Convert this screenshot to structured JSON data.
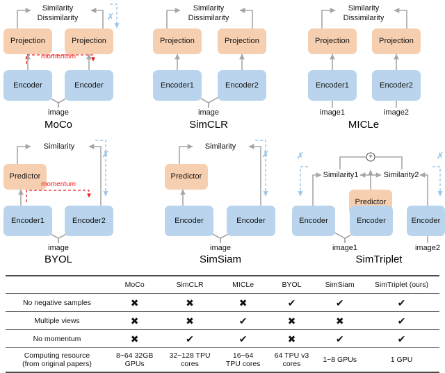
{
  "figure": {
    "diagrams": [
      {
        "id": "moco",
        "title": "MoCo",
        "top_labels": [
          "Similarity",
          "Dissimilarity"
        ],
        "boxes": [
          {
            "name": "projection-left",
            "label": "Projection"
          },
          {
            "name": "projection-right",
            "label": "Projection"
          },
          {
            "name": "encoder-left",
            "label": "Encoder"
          },
          {
            "name": "encoder-right",
            "label": "Encoder"
          }
        ],
        "input_labels": [
          "image"
        ],
        "momentum_label": "momentum",
        "stop_gradient_symbol": "✗"
      },
      {
        "id": "simclr",
        "title": "SimCLR",
        "top_labels": [
          "Similarity",
          "Dissimilarity"
        ],
        "boxes": [
          {
            "name": "projection-left",
            "label": "Projection"
          },
          {
            "name": "projection-right",
            "label": "Projection"
          },
          {
            "name": "encoder-left",
            "label": "Encoder1"
          },
          {
            "name": "encoder-right",
            "label": "Encoder2"
          }
        ],
        "input_labels": [
          "image"
        ]
      },
      {
        "id": "micle",
        "title": "MICLe",
        "top_labels": [
          "Similarity",
          "Dissimilarity"
        ],
        "boxes": [
          {
            "name": "projection-left",
            "label": "Projection"
          },
          {
            "name": "projection-right",
            "label": "Projection"
          },
          {
            "name": "encoder-left",
            "label": "Encoder1"
          },
          {
            "name": "encoder-right",
            "label": "Encoder2"
          }
        ],
        "input_labels": [
          "image1",
          "image2"
        ]
      },
      {
        "id": "byol",
        "title": "BYOL",
        "top_labels": [
          "Similarity"
        ],
        "boxes": [
          {
            "name": "predictor",
            "label": "Predictor"
          },
          {
            "name": "encoder-left",
            "label": "Encoder1"
          },
          {
            "name": "encoder-right",
            "label": "Encoder2"
          }
        ],
        "input_labels": [
          "image"
        ],
        "momentum_label": "momentum",
        "stop_gradient_symbol": "✗"
      },
      {
        "id": "simsiam",
        "title": "SimSiam",
        "top_labels": [
          "Similarity"
        ],
        "boxes": [
          {
            "name": "predictor",
            "label": "Predictor"
          },
          {
            "name": "encoder-left",
            "label": "Encoder"
          },
          {
            "name": "encoder-right",
            "label": "Encoder"
          }
        ],
        "input_labels": [
          "image"
        ],
        "stop_gradient_symbol": "✗"
      },
      {
        "id": "simtriplet",
        "title": "SimTriplet",
        "top_labels": [
          "Similarity1",
          "Similarity2"
        ],
        "sum_symbol": "+",
        "boxes": [
          {
            "name": "predictor",
            "label": "Predictor"
          },
          {
            "name": "encoder-left",
            "label": "Encoder"
          },
          {
            "name": "encoder-middle",
            "label": "Encoder"
          },
          {
            "name": "encoder-right",
            "label": "Encoder"
          }
        ],
        "input_labels": [
          "image1",
          "image2"
        ],
        "stop_gradient_symbol": "✗"
      }
    ]
  },
  "table": {
    "columns": [
      "",
      "MoCo",
      "SimCLR",
      "MICLe",
      "BYOL",
      "SimSiam",
      "SimTriplet (ours)"
    ],
    "rows": [
      {
        "label": "No negative samples",
        "values": [
          "no",
          "no",
          "no",
          "yes",
          "yes",
          "yes"
        ]
      },
      {
        "label": "Multiple views",
        "values": [
          "no",
          "no",
          "yes",
          "no",
          "no",
          "yes"
        ]
      },
      {
        "label": "No momentum",
        "values": [
          "no",
          "yes",
          "yes",
          "no",
          "yes",
          "yes"
        ]
      }
    ],
    "last_row": {
      "label_line1": "Computing resource",
      "label_line2": "(from original papers)",
      "values": [
        {
          "line1": "8~64 32GB",
          "line2": "GPUs"
        },
        {
          "line1": "32~128 TPU",
          "line2": "cores"
        },
        {
          "line1": "16~64",
          "line2": "TPU cores"
        },
        {
          "line1": "64 TPU v3",
          "line2": "cores"
        },
        {
          "line1": "1~8 GPUs",
          "line2": ""
        },
        {
          "line1": "1 GPU",
          "line2": ""
        }
      ]
    },
    "marks": {
      "yes": "✔",
      "no": "✖"
    }
  },
  "colors": {
    "projection_box": "#f6cfb0",
    "encoder_box": "#b9d4ec",
    "predictor_box": "#f6cfb0",
    "arrow_gray": "#a6a6a6",
    "stop_gradient_blue": "#9ec6e8",
    "momentum_red": "#ef1b1b",
    "check_green": "#7dd24a",
    "cross_red": "#cf1111"
  }
}
